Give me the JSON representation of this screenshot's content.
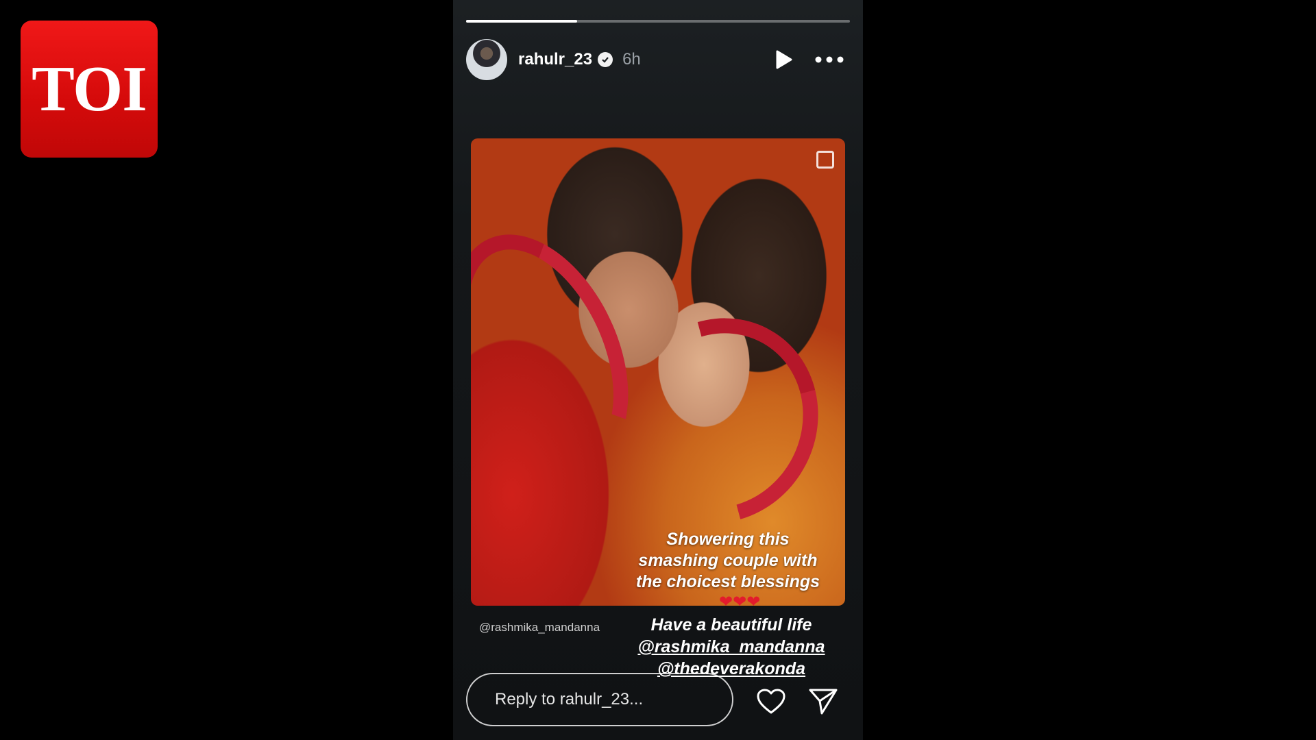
{
  "logo": {
    "text": "TOI",
    "color": "#e0100f"
  },
  "story": {
    "progress_fraction": 0.29,
    "header": {
      "username": "rahulr_23",
      "verified": true,
      "time_ago": "6h",
      "play_icon": "play-icon",
      "more_icon": "more-icon"
    },
    "photo": {
      "caption_lines": [
        "Showering this",
        "smashing couple with",
        "the choicest blessings"
      ],
      "hearts": "❤❤❤"
    },
    "mention_tag": "@rashmika_mandanna",
    "wish": {
      "line1": "Have a beautiful life",
      "mention1": "@rashmika_mandanna",
      "mention2": "@thedeverakonda"
    },
    "reply": {
      "placeholder": "Reply to rahulr_23..."
    },
    "actions": {
      "like_icon": "heart-icon",
      "share_icon": "send-icon"
    }
  }
}
